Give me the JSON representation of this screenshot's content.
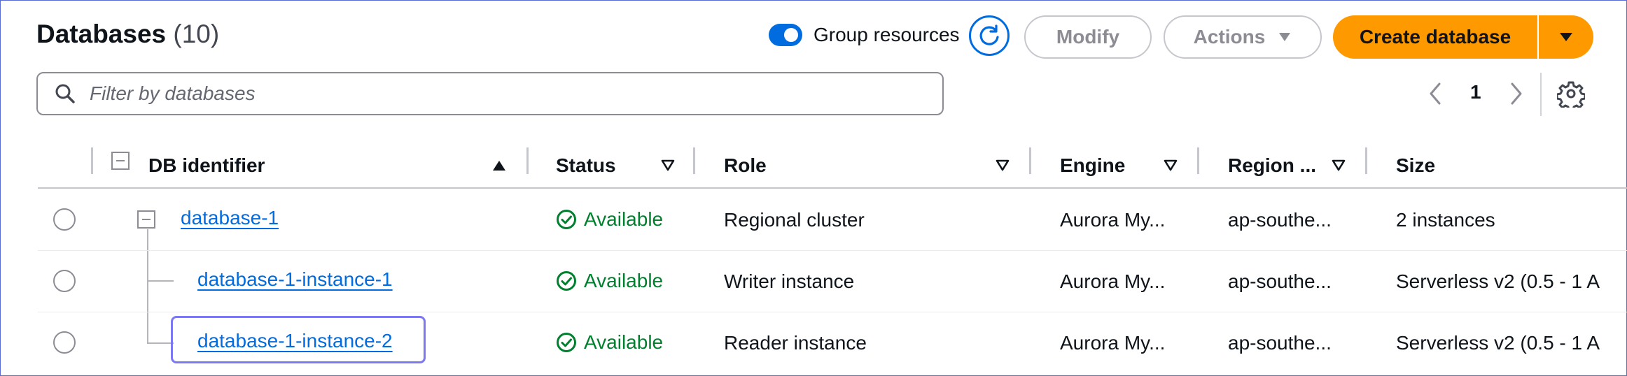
{
  "header": {
    "title": "Databases",
    "count": "(10)",
    "group_resources_label": "Group resources",
    "modify_label": "Modify",
    "actions_label": "Actions",
    "create_label": "Create database"
  },
  "filter": {
    "placeholder": "Filter by databases",
    "value": ""
  },
  "pagination": {
    "current_page": "1"
  },
  "table": {
    "columns": [
      "DB identifier",
      "Status",
      "Role",
      "Engine",
      "Region ...",
      "Size"
    ],
    "rows": [
      {
        "id": "database-1",
        "status": "Available",
        "role": "Regional cluster",
        "engine": "Aurora My...",
        "region": "ap-southe...",
        "size": "2 instances"
      },
      {
        "id": "database-1-instance-1",
        "status": "Available",
        "role": "Writer instance",
        "engine": "Aurora My...",
        "region": "ap-southe...",
        "size": "Serverless v2 (0.5 - 1 A"
      },
      {
        "id": "database-1-instance-2",
        "status": "Available",
        "role": "Reader instance",
        "engine": "Aurora My...",
        "region": "ap-southe...",
        "size": "Serverless v2 (0.5 - 1 A"
      }
    ]
  },
  "colors": {
    "primary": "#006ce0",
    "create_button": "#ff9900",
    "status_available": "#00802f",
    "focus_ring": "#7b78f0"
  },
  "icons": {
    "search": "search-icon",
    "refresh": "refresh-icon",
    "settings": "gear-icon",
    "status": "check-circle-icon"
  }
}
